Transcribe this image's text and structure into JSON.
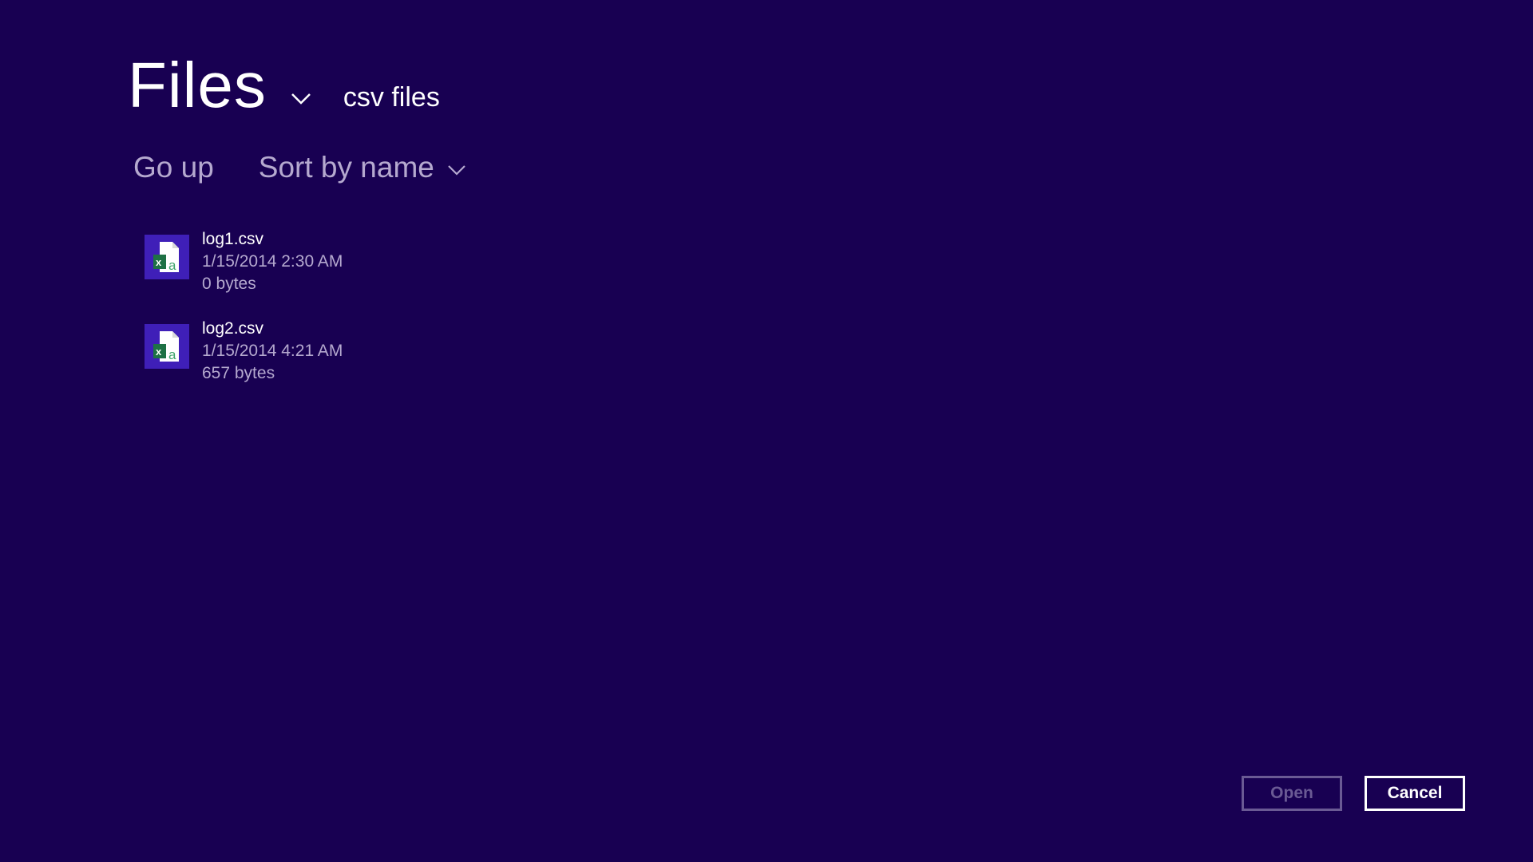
{
  "header": {
    "title": "Files",
    "subtitle": "csv files"
  },
  "commands": {
    "go_up": "Go up",
    "sort": "Sort by name"
  },
  "files": [
    {
      "name": "log1.csv",
      "date": "1/15/2014 2:30 AM",
      "size": "0 bytes",
      "icon": "excel-csv-icon"
    },
    {
      "name": "log2.csv",
      "date": "1/15/2014 4:21 AM",
      "size": "657 bytes",
      "icon": "excel-csv-icon"
    }
  ],
  "buttons": {
    "open": "Open",
    "cancel": "Cancel"
  },
  "colors": {
    "background": "#180052",
    "icon_tile": "#3f1fb8",
    "secondary_text": "#b5a9cf",
    "disabled": "#6a5a94"
  }
}
